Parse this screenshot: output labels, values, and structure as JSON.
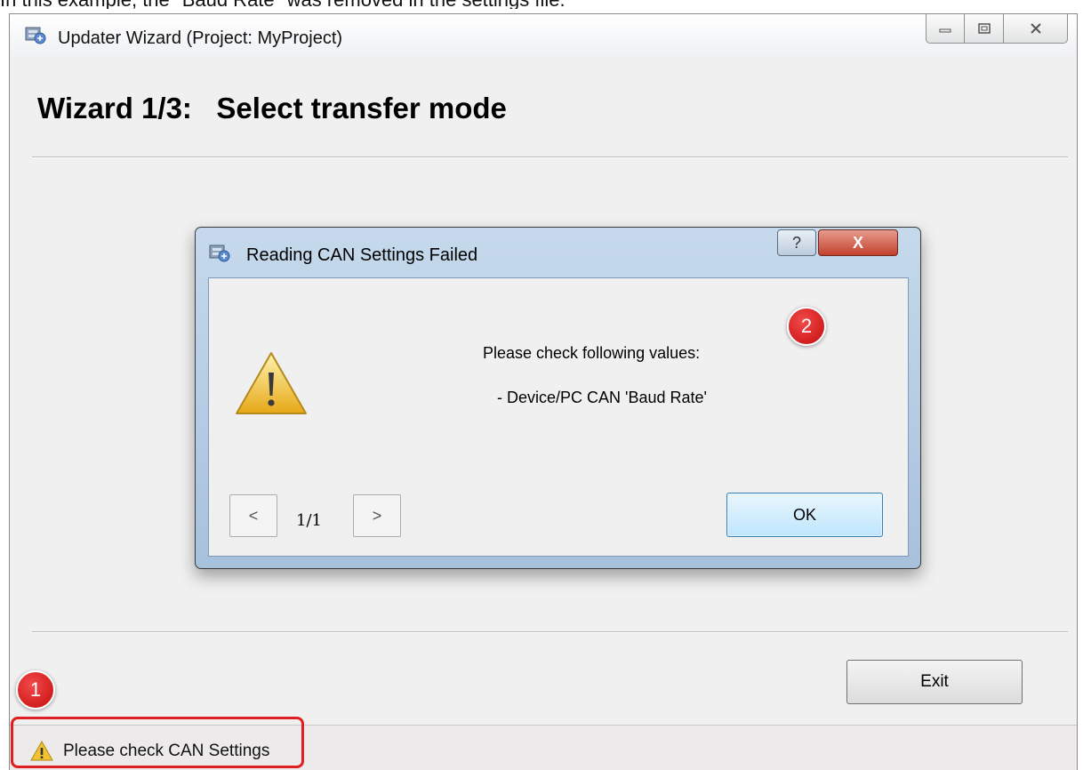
{
  "page_caption": "In this example, the \"Baud Rate\" was removed in the settings file.",
  "window": {
    "title": "Updater Wizard (Project: MyProject)",
    "heading": "Wizard 1/3:   Select transfer mode",
    "exit_label": "Exit",
    "status_text": "Please check CAN Settings"
  },
  "dialog": {
    "title": "Reading CAN Settings Failed",
    "help_glyph": "?",
    "close_glyph": "X",
    "message_line1": "Please check following values:",
    "message_line2": "- Device/PC CAN 'Baud Rate'",
    "prev_label": "<",
    "page_indicator": "1/1",
    "next_label": ">",
    "ok_label": "OK"
  },
  "annotations": {
    "marker1": "1",
    "marker2": "2",
    "color": "#d81a1a"
  }
}
